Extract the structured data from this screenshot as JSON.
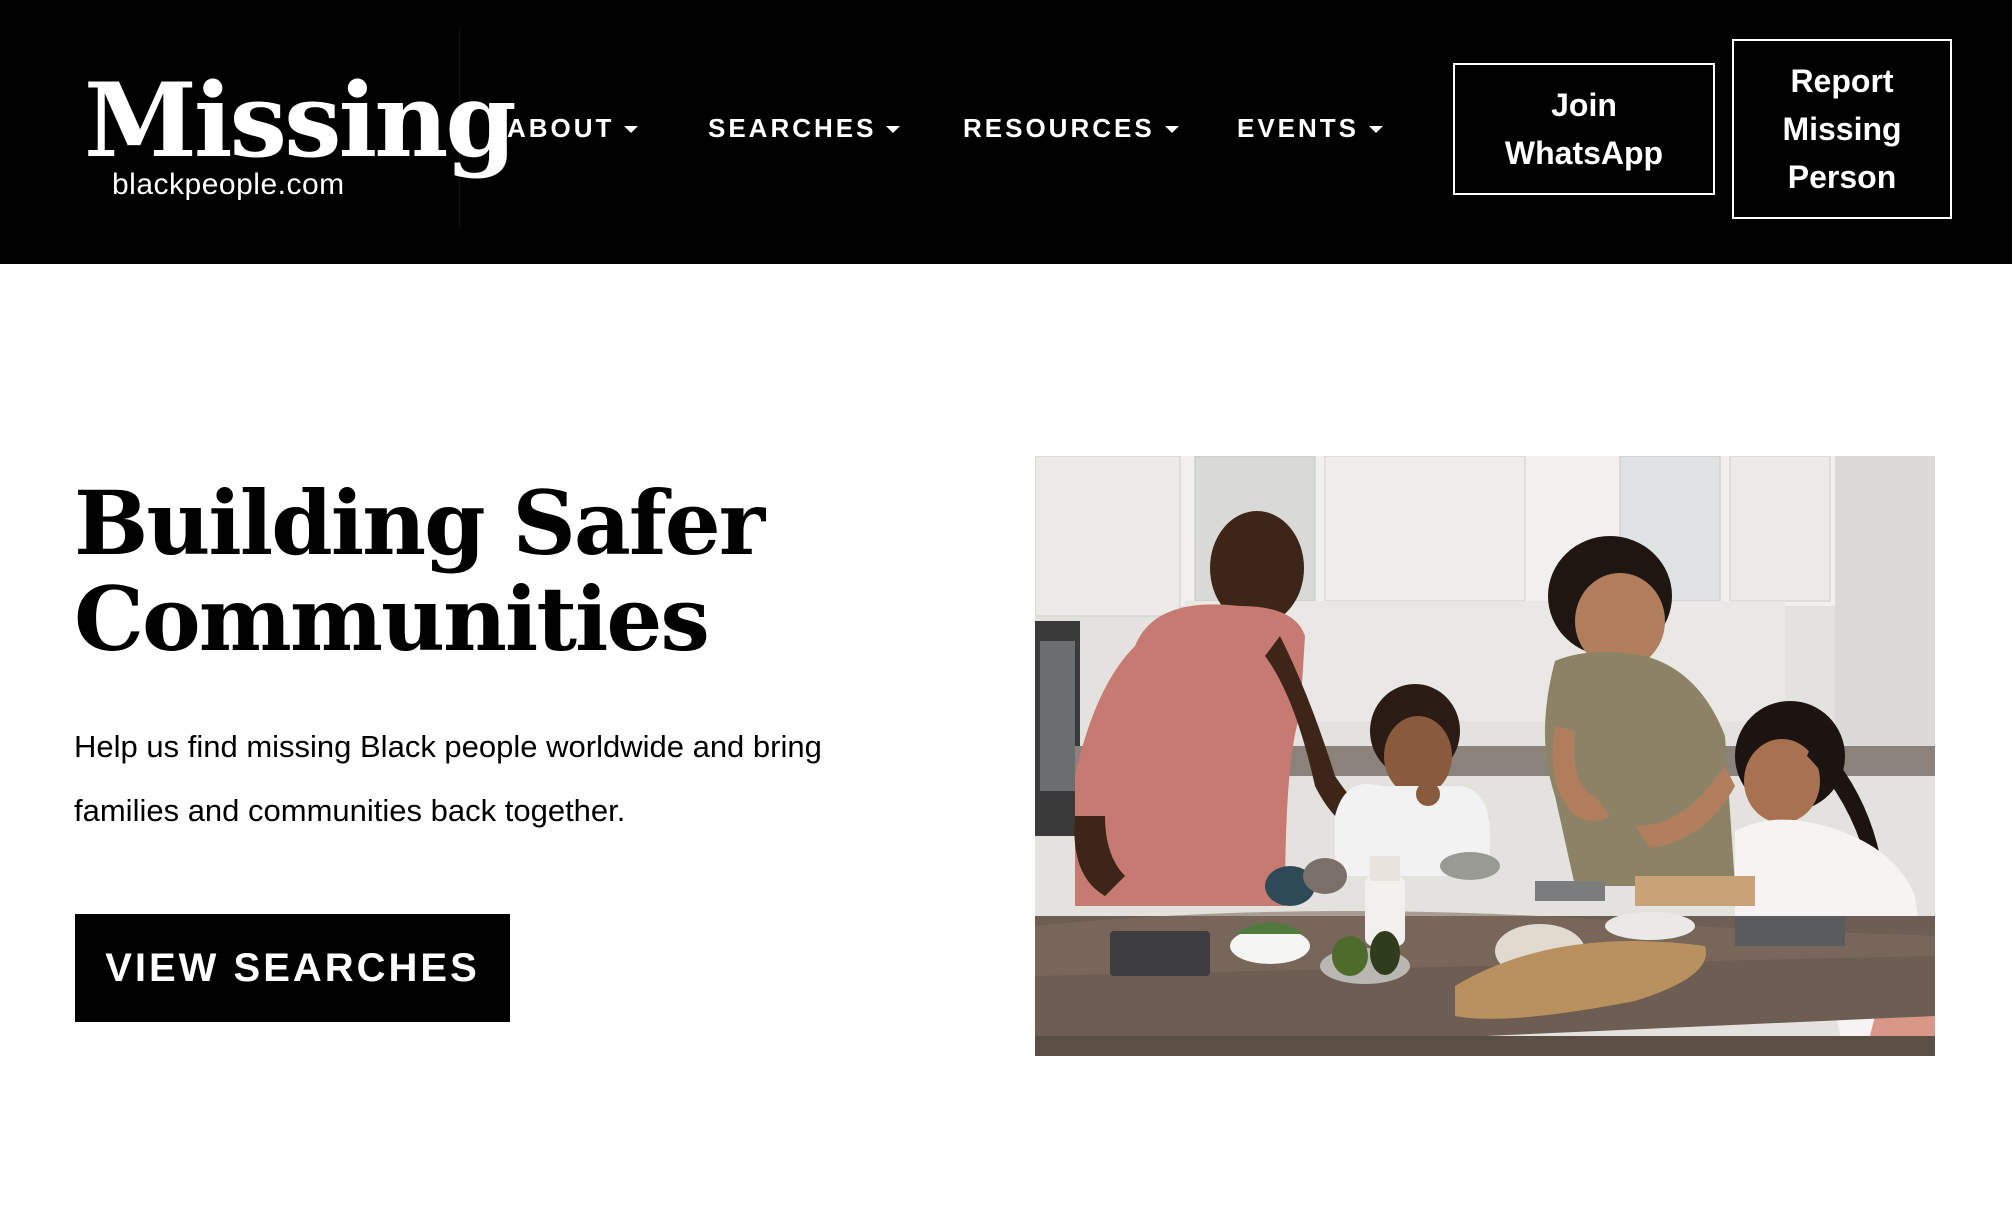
{
  "header": {
    "logo": {
      "word": "Missing",
      "domain": "blackpeople.com"
    },
    "nav": [
      {
        "label": "ABOUT"
      },
      {
        "label": "SEARCHES"
      },
      {
        "label": "RESOURCES"
      },
      {
        "label": "EVENTS"
      }
    ],
    "buttons": {
      "whatsapp_line1": "Join",
      "whatsapp_line2": "WhatsApp",
      "report_line1": "Report",
      "report_line2": "Missing",
      "report_line3": "Person"
    }
  },
  "hero": {
    "title_line1": "Building Safer",
    "title_line2": "Communities",
    "text_line1": "Help us find missing Black people worldwide and bring",
    "text_line2": "families and communities back together.",
    "cta_label": "VIEW SEARCHES"
  },
  "colors": {
    "header_bg": "#000000",
    "page_bg": "#ffffff",
    "text": "#000000"
  },
  "icons": {
    "nav_caret": "caret-down-icon"
  }
}
